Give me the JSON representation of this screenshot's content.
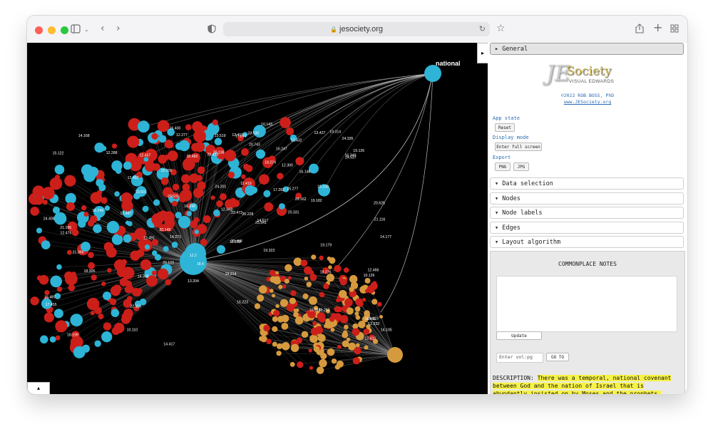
{
  "browser": {
    "url": "jesociety.org",
    "traffic_colors": [
      "#ff5f57",
      "#febc2e",
      "#28c840"
    ]
  },
  "graph": {
    "national_label": "national",
    "hub_node_labels": [
      "12.2",
      "18.4"
    ],
    "blue_labels": [
      "23.531",
      "23.530",
      "23.501",
      "23.472",
      "20.743",
      "25.277",
      "16.400",
      "20.413",
      "23.468",
      "12.133",
      "16.290",
      "23.519",
      "20.331",
      "25.228",
      "16.148",
      "12.343",
      "14.617",
      "12.277",
      "16.247",
      "12.432"
    ],
    "red_labels": [
      "19.179",
      "21.366",
      "20.138",
      "19.126",
      "12.300",
      "24.537",
      "16.349",
      "20.625",
      "14.271",
      "18.199",
      "12.487",
      "12.491",
      "19.263",
      "18.276",
      "14.177",
      "20.483",
      "21.196",
      "15.014",
      "12.492",
      "12.457",
      "17.455",
      "25.541",
      "19.314",
      "15.497",
      "24.335",
      "12.475",
      "14.168",
      "20.149",
      "22.110",
      "10.143",
      "14.417",
      "19.182",
      "12.410",
      "10.110",
      "21.116",
      "20.200",
      "20.103",
      "16.249",
      "12.288",
      "24.408",
      "19.323",
      "13.427",
      "19.214",
      "15.100",
      "24.201",
      "14.348",
      "12.233",
      "18.224",
      "16.223",
      "13.204",
      "17.245",
      "20.162",
      "12.417",
      "11.419",
      "18.305",
      "17.282",
      "15.122"
    ],
    "orange_labels": [
      "10.126",
      "14.411",
      "12.466",
      "14.105",
      "16.410"
    ],
    "colors": {
      "background": "#000000",
      "blue": "#2eb4d6",
      "red": "#cc1f1a",
      "orange": "#d69a3e",
      "edge": "#8c8c8c"
    }
  },
  "panel": {
    "sections": {
      "general": "▸ General",
      "data_selection": "▾ Data selection",
      "nodes": "▾ Nodes",
      "node_labels": "▾ Node labels",
      "edges": "▾ Edges",
      "layout": "▾ Layout algorithm"
    },
    "logo": {
      "letters": "JE",
      "society": "Society",
      "tagline": "VISUAL EDWARDS"
    },
    "copyright": "©2022 ROB BOSS, PhD",
    "website": "www.JESociety.org",
    "app_state_label": "App state",
    "reset": "Reset",
    "display_mode_label": "Display mode",
    "fullscreen": "Enter full screen",
    "export_label": "Export",
    "png": "PNG",
    "jpg": "JPG",
    "notes": {
      "title": "COMMONPLACE NOTES",
      "update": "Update",
      "input_placeholder": "Enter vol:pg",
      "goto": "GO TO",
      "desc_label": "DESCRIPTION: ",
      "desc_text": "There was a temporal, national covenant between God and the nation of Israel that is abundantly insisted on by Moses and the prophets, which they have"
    }
  }
}
